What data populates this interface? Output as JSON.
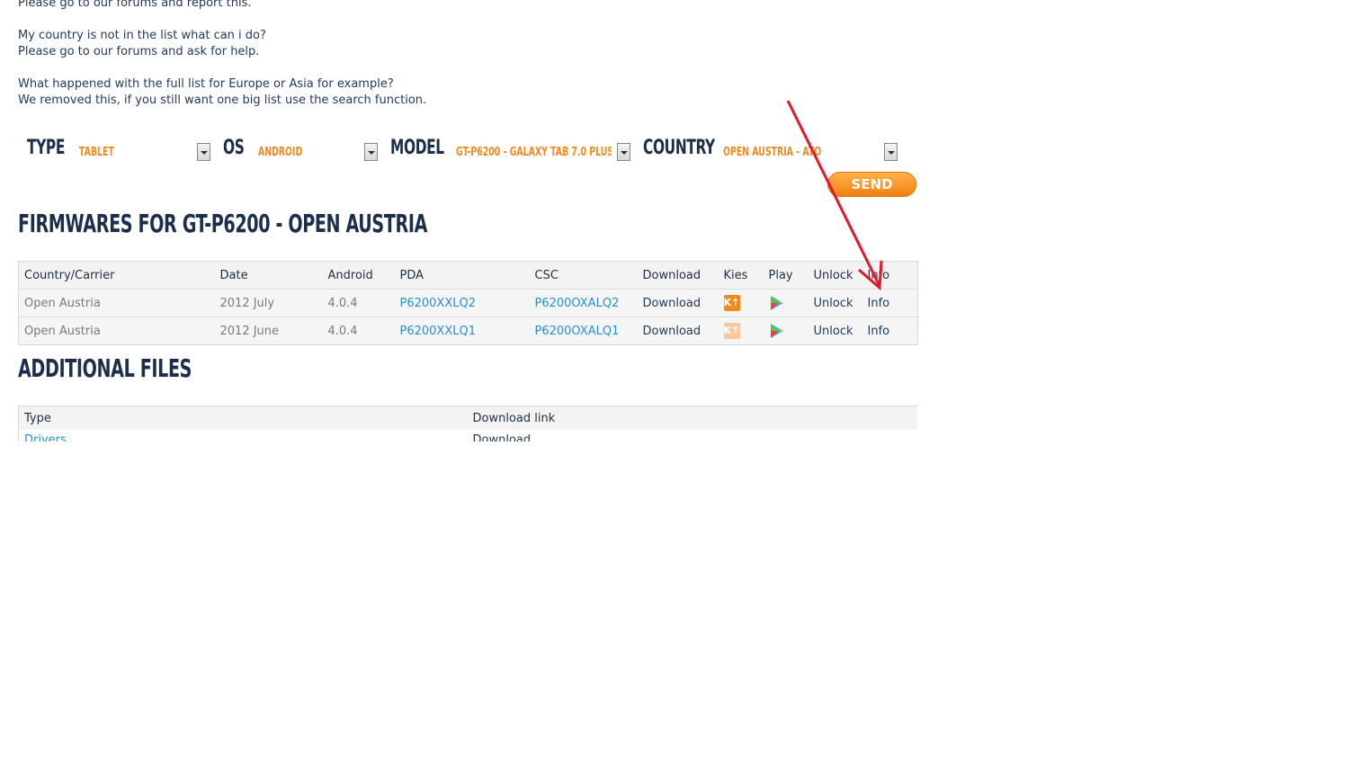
{
  "faq": [
    {
      "q": "",
      "a": "Please go to our forums and report this."
    },
    {
      "q": "My country is not in the list what can i do?",
      "a": "Please go to our forums and ask for help."
    },
    {
      "q": "What happened with the full list for Europe or Asia for example?",
      "a": "We removed this, if you still want one big list use the search function."
    }
  ],
  "filters": {
    "type_label": "TYPE",
    "type_value": "TABLET",
    "os_label": "OS",
    "os_value": "ANDROID",
    "model_label": "MODEL",
    "model_value": "GT-P6200 - GALAXY TAB 7.0 PLUS",
    "country_label": "COUNTRY",
    "country_value": "OPEN AUSTRIA - ATO",
    "send_label": "SEND"
  },
  "firmwares": {
    "title": "FIRMWARES FOR GT-P6200 - OPEN AUSTRIA",
    "columns": [
      "Country/Carrier",
      "Date",
      "Android",
      "PDA",
      "CSC",
      "Download",
      "Kies",
      "Play",
      "Unlock",
      "Info"
    ],
    "rows": [
      {
        "carrier": "Open Austria",
        "date": "2012 July",
        "android": "4.0.4",
        "pda": "P6200XXLQ2",
        "csc": "P6200OXALQ2",
        "download": "Download",
        "kies": "K↑",
        "play": "play-store-icon",
        "unlock": "Unlock",
        "info": "Info"
      },
      {
        "carrier": "Open Austria",
        "date": "2012 June",
        "android": "4.0.4",
        "pda": "P6200XXLQ1",
        "csc": "P6200OXALQ1",
        "download": "Download",
        "kies": "K↑",
        "play": "play-store-icon",
        "unlock": "Unlock",
        "info": "Info"
      }
    ]
  },
  "additional": {
    "title": "ADDITIONAL FILES",
    "columns": [
      "Type",
      "Download link"
    ],
    "rows": [
      {
        "type": "Drivers",
        "link": "Download"
      }
    ]
  },
  "annotation": {
    "color": "#e01a2a"
  }
}
